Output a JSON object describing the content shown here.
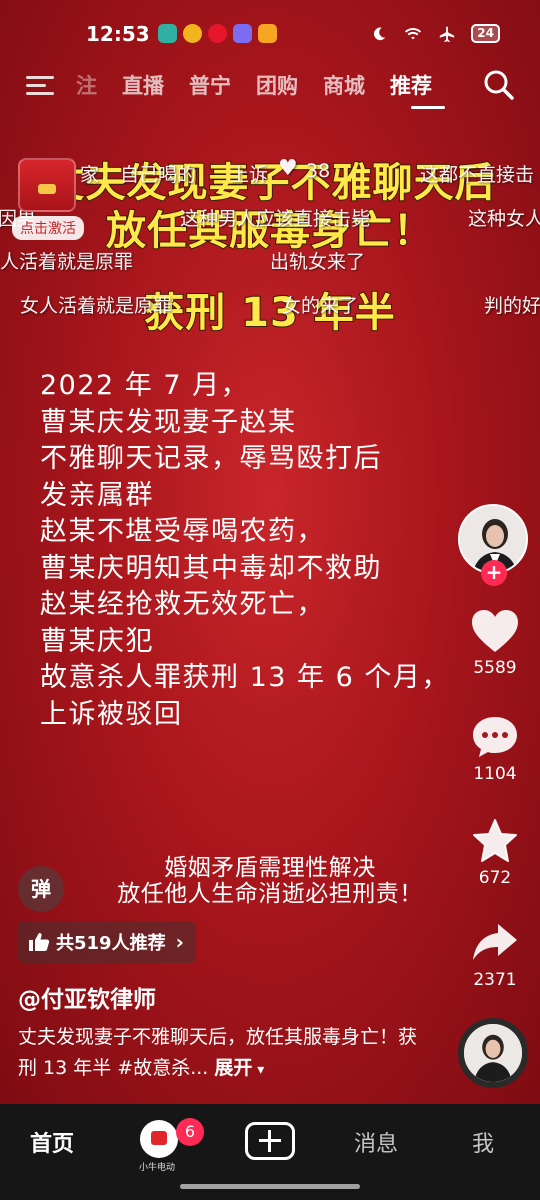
{
  "status_bar": {
    "time": "12:53",
    "battery": "24"
  },
  "top_nav": {
    "tabs": [
      "注",
      "直播",
      "普宁",
      "团购",
      "商城",
      "推荐"
    ],
    "active_tab": "推荐"
  },
  "title_overlay": {
    "line1": "丈夫发现妻子不雅聊天后",
    "line2": "放任其服毒身亡！",
    "line3": "获刑 13 年半"
  },
  "danmaku": [
    "家",
    "自己喝的",
    "上诉",
    "38",
    "这都不直接击",
    "因男",
    "这种男人应该直接击毙",
    "这种女人",
    "人活着就是原罪",
    "出轨女来了",
    "女人活着就是原罪",
    "女的来了",
    "判的好"
  ],
  "red_packet": {
    "label": "点击激活"
  },
  "body_text": [
    "2022 年 7 月，",
    "曹某庆发现妻子赵某",
    "不雅聊天记录，辱骂殴打后",
    "发亲属群",
    "赵某不堪受辱喝农药，",
    "曹某庆明知其中毒却不救助",
    "赵某经抢救无效死亡，",
    "曹某庆犯",
    "故意杀人罪获刑 13 年 6 个月，",
    "上诉被驳回"
  ],
  "subtitle": {
    "line1": "婚姻矛盾需理性解决",
    "line2": "放任他人生命消逝必担刑责！"
  },
  "actions": {
    "like_count": "5589",
    "comment_count": "1104",
    "favorite_count": "672",
    "share_count": "2371"
  },
  "danmu_toggle": "弹",
  "recommend": {
    "label": "共519人推荐"
  },
  "author": "@付亚钦律师",
  "description": {
    "text": "丈夫发现妻子不雅聊天后，放任其服毒身亡！获刑 13 年半 #故意杀...",
    "expand": "展开"
  },
  "bottom_nav": {
    "home": "首页",
    "niu_label": "小牛电动",
    "niu_badge": "6",
    "messages": "消息",
    "me": "我"
  },
  "colors": {
    "background_red": "#a8161c",
    "title_yellow": "#ffe94a",
    "accent_pink": "#fe2c55",
    "nav_bg": "#161616"
  }
}
